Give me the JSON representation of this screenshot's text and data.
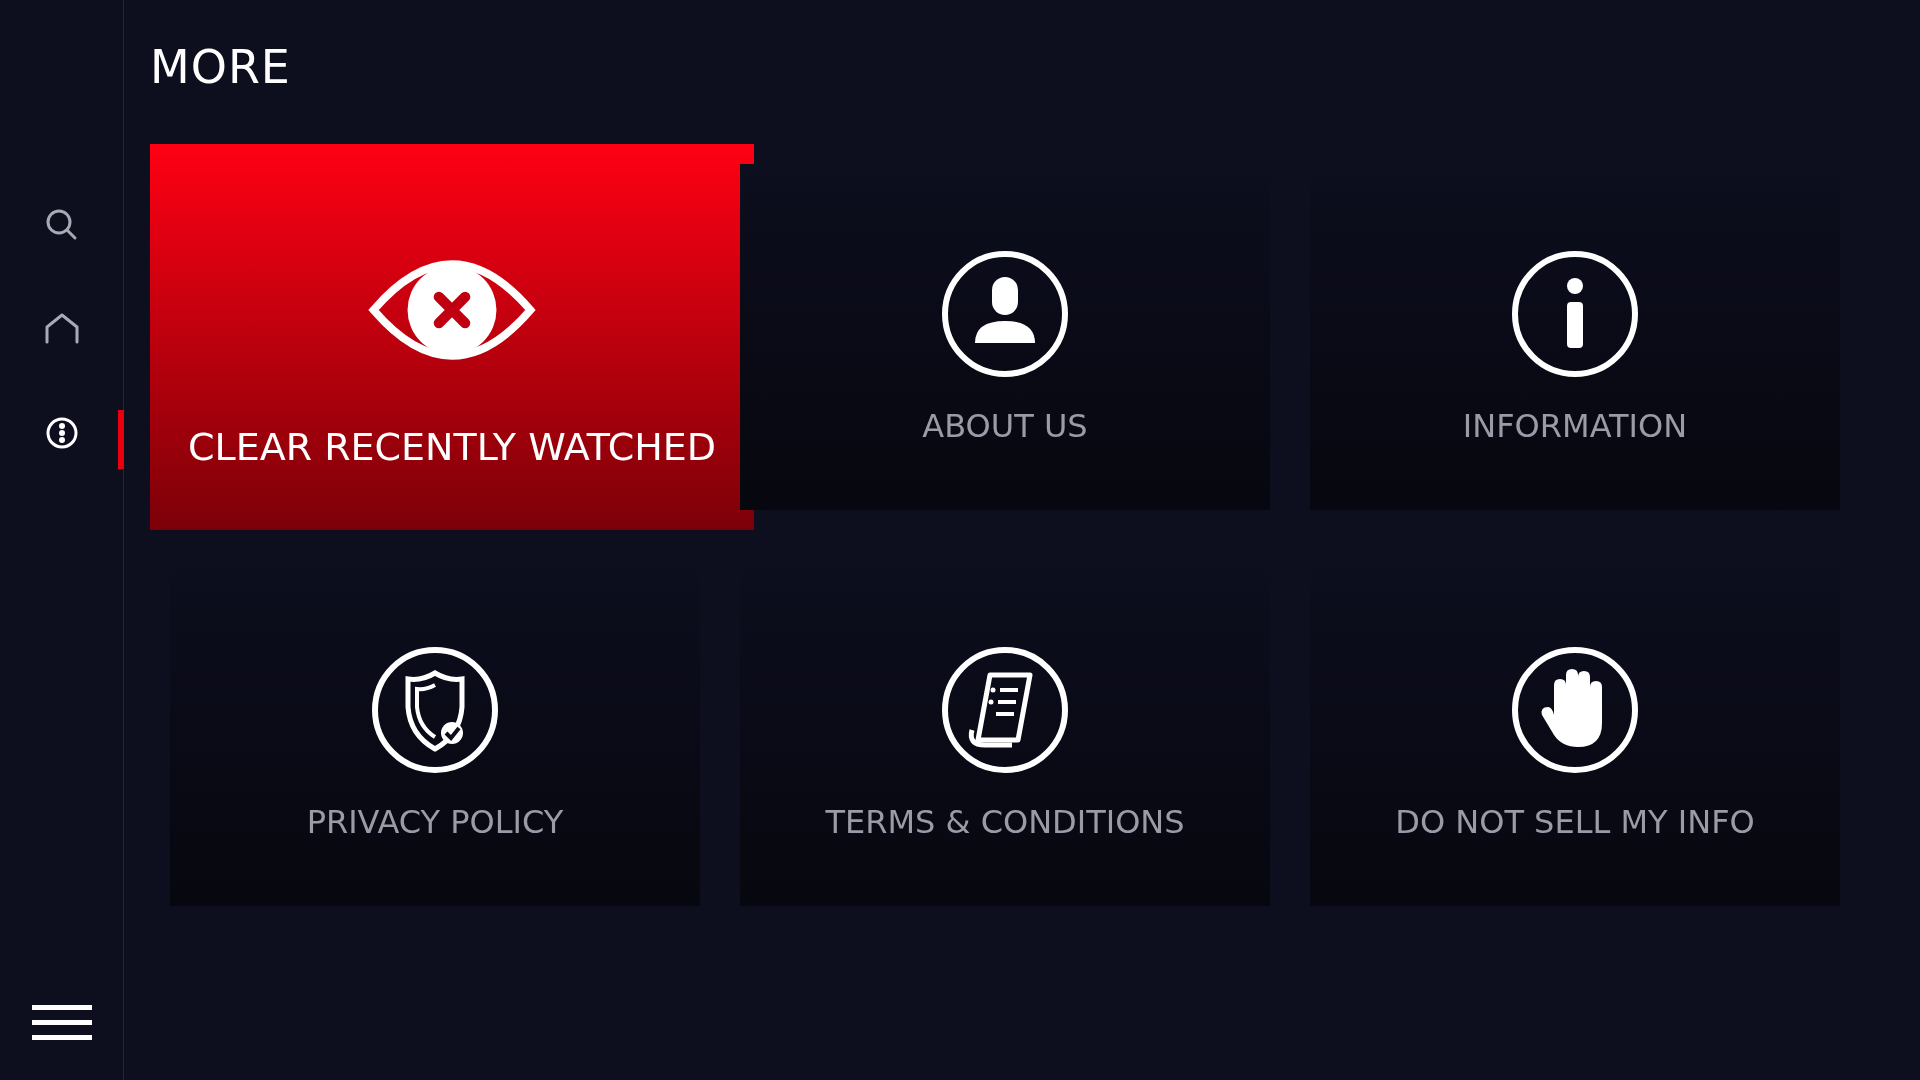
{
  "page_title": "MORE",
  "nav": [
    {
      "selected": false
    },
    {
      "selected": false
    },
    {
      "selected": true
    }
  ],
  "tiles": [
    {
      "label": "CLEAR RECENTLY WATCHED",
      "selected": true
    },
    {
      "label": "ABOUT US",
      "selected": false
    },
    {
      "label": "INFORMATION",
      "selected": false
    },
    {
      "label": "PRIVACY POLICY",
      "selected": false
    },
    {
      "label": "TERMS & CONDITIONS",
      "selected": false
    },
    {
      "label": "DO NOT SELL MY INFO",
      "selected": false
    }
  ]
}
